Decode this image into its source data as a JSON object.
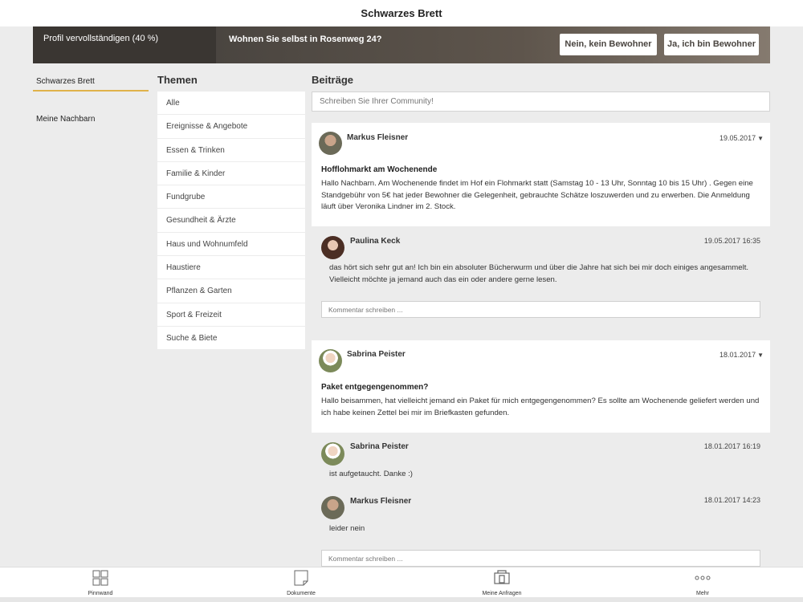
{
  "header": {
    "title": "Schwarzes Brett"
  },
  "banner": {
    "profile": "Profil vervollständigen (40 %)",
    "question": "Wohnen Sie selbst in Rosenweg 24?",
    "no_button": "Nein, kein Bewohner",
    "yes_button": "Ja, ich bin Bewohner"
  },
  "sidebar": {
    "items": [
      {
        "label": "Schwarzes Brett"
      },
      {
        "label": "Meine Nachbarn"
      }
    ]
  },
  "themen": {
    "title": "Themen",
    "items": [
      "Alle",
      "Ereignisse & Angebote",
      "Essen & Trinken",
      "Familie & Kinder",
      "Fundgrube",
      "Gesundheit & Ärzte",
      "Haus und Wohnumfeld",
      "Haustiere",
      "Pflanzen & Garten",
      "Sport & Freizeit",
      "Suche & Biete"
    ]
  },
  "beitraege": {
    "title": "Beiträge",
    "placeholder": "Schreiben Sie Ihrer Community!"
  },
  "posts": [
    {
      "author": "Markus Fleisner",
      "date": "19.05.2017",
      "title": "Hofflohmarkt am Wochenende",
      "body": "Hallo Nachbarn. Am Wochenende findet im Hof ein Flohmarkt statt (Samstag 10 - 13 Uhr, Sonntag 10 bis 15 Uhr) . Gegen eine Standgebühr von 5€ hat jeder Bewohner die Gelegenheit, gebrauchte Schätze loszuwerden und zu erwerben. Die Anmeldung läuft über Veronika Lindner im 2. Stock.",
      "comments": [
        {
          "author": "Paulina Keck",
          "date": "19.05.2017 16:35",
          "text": "das hört sich sehr gut an! Ich bin ein absoluter Bücherwurm und über die Jahre hat sich bei mir doch einiges angesammelt. Vielleicht möchte ja jemand auch das ein oder andere gerne lesen."
        }
      ],
      "comment_placeholder": "Kommentar schreiben ..."
    },
    {
      "author": "Sabrina Peister",
      "date": "18.01.2017",
      "title": "Paket entgegengenommen?",
      "body": "Hallo beisammen, hat vielleicht jemand ein Paket für mich entgegengenommen? Es sollte am Wochenende geliefert werden und ich habe keinen Zettel bei mir im Briefkasten gefunden.",
      "comments": [
        {
          "author": "Sabrina Peister",
          "date": "18.01.2017 16:19",
          "text": "ist aufgetaucht. Danke :)"
        },
        {
          "author": "Markus Fleisner",
          "date": "18.01.2017 14:23",
          "text": "leider nein"
        }
      ],
      "comment_placeholder": "Kommentar schreiben ..."
    }
  ],
  "tabbar": {
    "items": [
      {
        "label": "Pinnwand",
        "icon": "grid-icon"
      },
      {
        "label": "Dokumente",
        "icon": "document-icon"
      },
      {
        "label": "Meine Anfragen",
        "icon": "requests-icon"
      },
      {
        "label": "Mehr",
        "icon": "more-icon"
      }
    ]
  }
}
